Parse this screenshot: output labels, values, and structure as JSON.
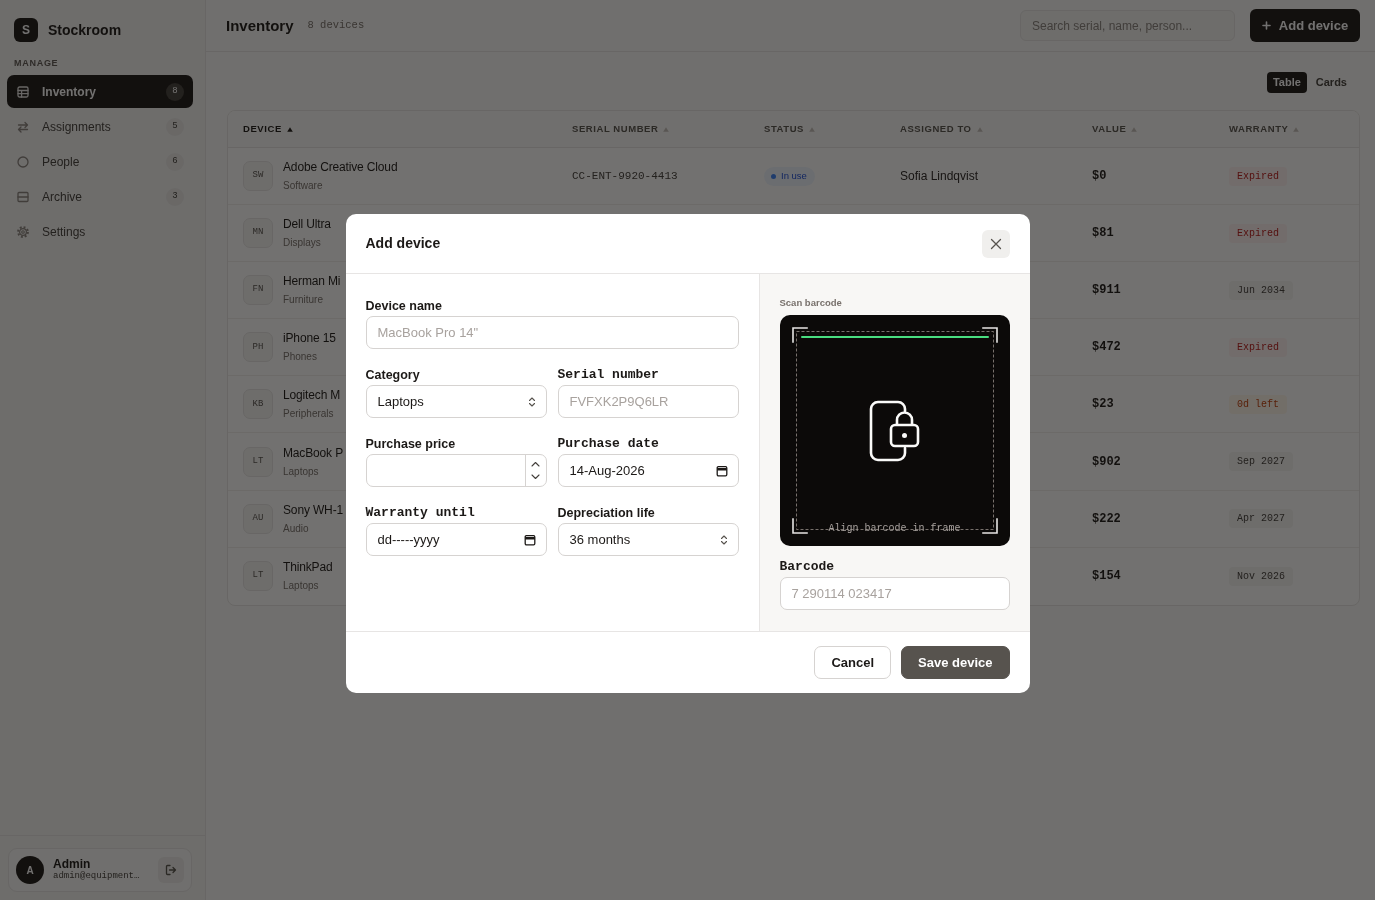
{
  "sidebar": {
    "brand": {
      "mark": "S",
      "name": "Stockroom"
    },
    "section": "MANAGE",
    "items": [
      {
        "label": "Inventory",
        "count": "8",
        "selected": true
      },
      {
        "label": "Assignments",
        "count": "5",
        "selected": false
      },
      {
        "label": "People",
        "count": "6",
        "selected": false
      },
      {
        "label": "Archive",
        "count": "3",
        "selected": false
      },
      {
        "label": "Settings",
        "selected": false
      }
    ],
    "user": {
      "initial": "A",
      "name": "Admin",
      "email": "admin@equipment…"
    }
  },
  "header": {
    "title": "Inventory",
    "subtitle": "8 devices",
    "search": {
      "placeholder": "Search serial, name, person..."
    },
    "add_button": "Add device"
  },
  "view_toggle": [
    {
      "label": "Table",
      "selected": true
    },
    {
      "label": "Cards",
      "selected": false
    }
  ],
  "table": {
    "columns": [
      {
        "label": "DEVICE",
        "sorted": true
      },
      {
        "label": "SERIAL NUMBER",
        "sorted": false
      },
      {
        "label": "STATUS",
        "sorted": false
      },
      {
        "label": "ASSIGNED TO",
        "sorted": false
      },
      {
        "label": "VALUE",
        "sorted": false
      },
      {
        "label": "WARRANTY",
        "sorted": false
      }
    ],
    "rows": [
      {
        "initials": "SW",
        "name": "Adobe Creative Cloud",
        "category": "Software",
        "serial": "CC-ENT-9920-4413",
        "status": {
          "label": "In use",
          "kind": "in_use"
        },
        "assigned_to": "Sofia Lindqvist",
        "value": "$0",
        "warranty": {
          "label": "Expired",
          "kind": "expired"
        }
      },
      {
        "initials": "MN",
        "name": "Dell Ultra",
        "category": "Displays",
        "value": "$81",
        "warranty": {
          "label": "Expired",
          "kind": "expired"
        }
      },
      {
        "initials": "FN",
        "name": "Herman Mi",
        "category": "Furniture",
        "value": "$911",
        "warranty": {
          "label": "Jun 2034",
          "kind": "date"
        }
      },
      {
        "initials": "PH",
        "name": "iPhone 15",
        "category": "Phones",
        "value": "$472",
        "warranty": {
          "label": "Expired",
          "kind": "expired"
        }
      },
      {
        "initials": "KB",
        "name": "Logitech M",
        "category": "Peripherals",
        "value": "$23",
        "warranty": {
          "label": "0d left",
          "kind": "soon"
        }
      },
      {
        "initials": "LT",
        "name": "MacBook P",
        "category": "Laptops",
        "value": "$902",
        "warranty": {
          "label": "Sep 2027",
          "kind": "date"
        }
      },
      {
        "initials": "AU",
        "name": "Sony WH-1",
        "category": "Audio",
        "value": "$222",
        "warranty": {
          "label": "Apr 2027",
          "kind": "date"
        }
      },
      {
        "initials": "LT",
        "name": "ThinkPad",
        "category": "Laptops",
        "value": "$154",
        "warranty": {
          "label": "Nov 2026",
          "kind": "date"
        }
      }
    ]
  },
  "modal": {
    "title": "Add device",
    "fields": [
      {
        "label": "Device name",
        "kind": "text",
        "placeholder": "MacBook Pro 14\""
      },
      {
        "label": "Category",
        "kind": "select",
        "value": "Laptops"
      },
      {
        "label": "Serial number",
        "kind": "code",
        "placeholder": "FVFXK2P9Q6LR"
      },
      {
        "label": "Purchase price",
        "kind": "number"
      },
      {
        "label": "Purchase date",
        "kind": "date",
        "value": "14-Aug-2026"
      },
      {
        "label": "Warranty until",
        "kind": "date",
        "placeholder": "dd-----yyyy"
      },
      {
        "label": "Depreciation life",
        "kind": "select",
        "value": "36 months"
      }
    ],
    "scanner": {
      "label": "Scan barcode",
      "hint": "Align barcode in frame"
    },
    "barcode": {
      "label": "Barcode",
      "kind": "code",
      "placeholder": "7 290114 023417"
    },
    "buttons": [
      {
        "label": "Cancel",
        "kind": "secondary"
      },
      {
        "label": "Save device",
        "kind": "primary"
      }
    ]
  }
}
